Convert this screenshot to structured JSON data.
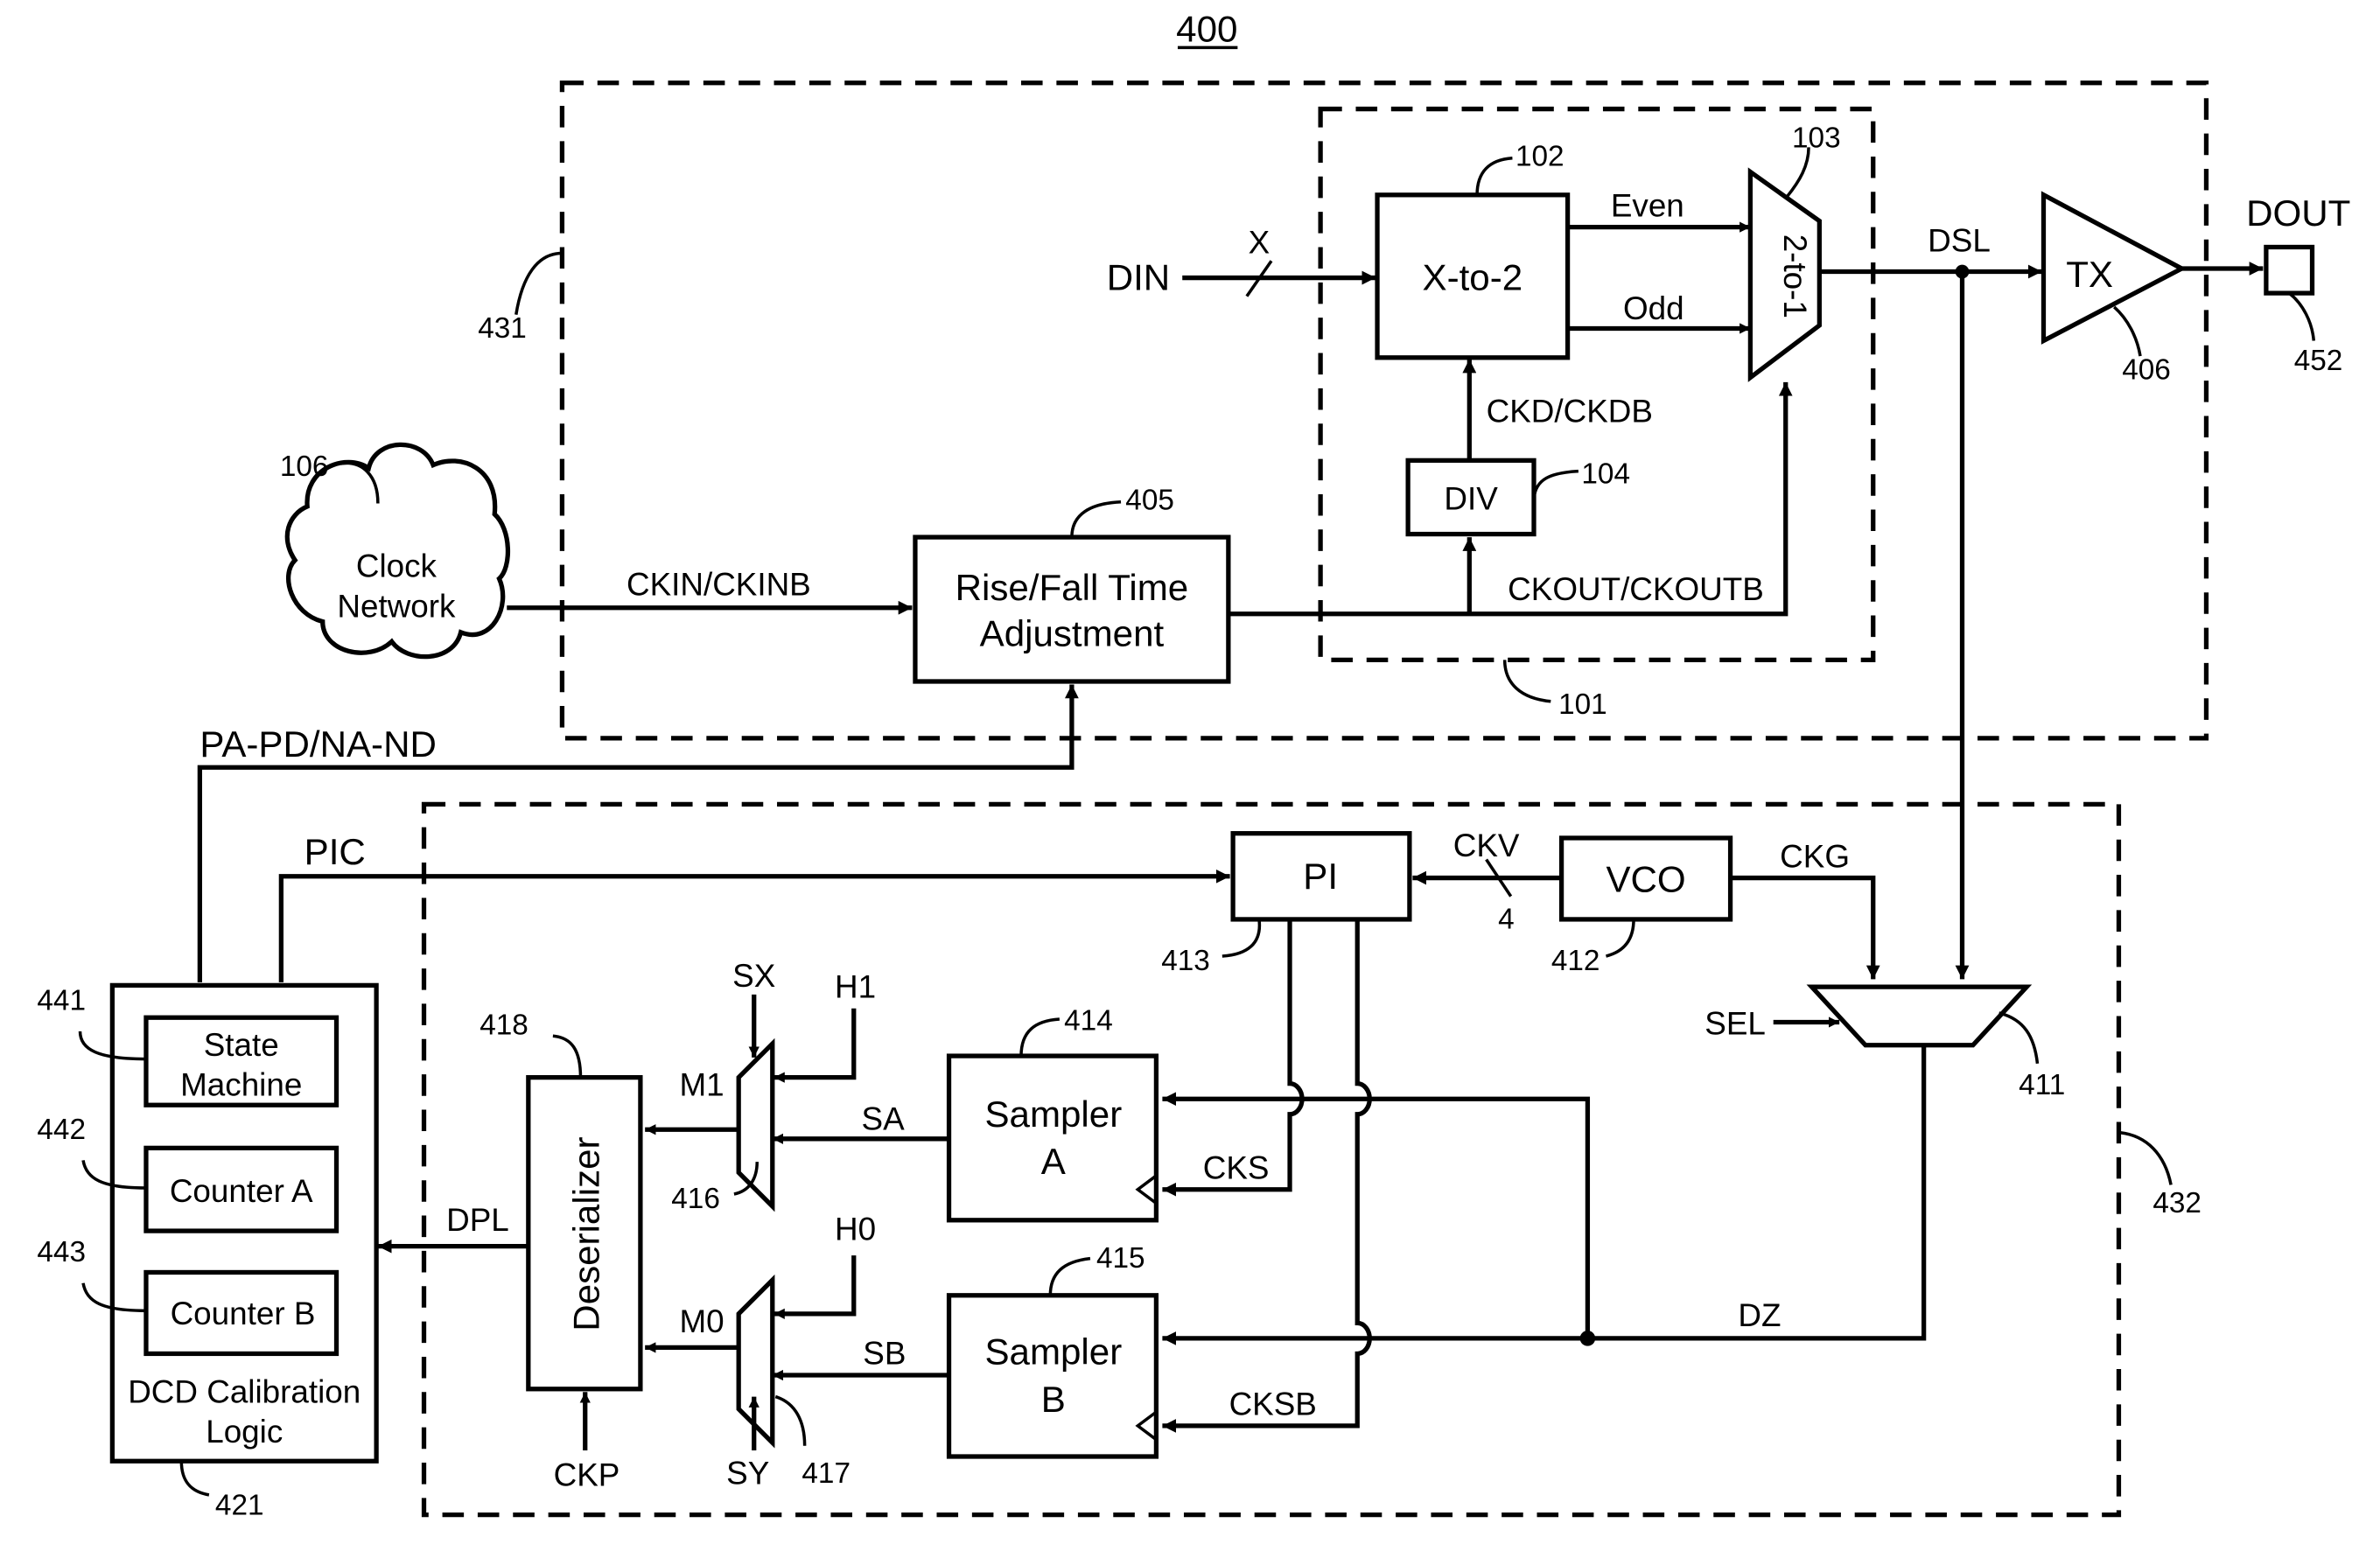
{
  "figure": {
    "number": "400",
    "colors": {
      "ink": "#000000",
      "background": "#ffffff"
    }
  },
  "regions": {
    "tx_region_ref": "431",
    "serializer_region_ref": "101",
    "rx_region_ref": "432"
  },
  "blocks": {
    "clock_network": {
      "ref": "106",
      "line1": "Clock",
      "line2": "Network"
    },
    "rise_fall": {
      "ref": "405",
      "line1": "Rise/Fall Time",
      "line2": "Adjustment"
    },
    "x_to_2": {
      "ref": "102",
      "label": "X-to-2"
    },
    "div": {
      "ref": "104",
      "label": "DIV"
    },
    "mux_2to1": {
      "ref": "103",
      "label": "2-to-1"
    },
    "tx": {
      "ref": "406",
      "label": "TX"
    },
    "dout_pad": {
      "ref": "452",
      "label": "DOUT"
    },
    "pi": {
      "ref": "413",
      "label": "PI"
    },
    "vco": {
      "ref": "412",
      "label": "VCO"
    },
    "mux_411": {
      "ref": "411"
    },
    "sampler_a": {
      "ref": "414",
      "line1": "Sampler",
      "line2": "A"
    },
    "sampler_b": {
      "ref": "415",
      "line1": "Sampler",
      "line2": "B"
    },
    "mux_416": {
      "ref": "416"
    },
    "mux_417": {
      "ref": "417"
    },
    "deserializer": {
      "ref": "418",
      "label": "Deserializer"
    },
    "dcd_logic": {
      "ref": "421",
      "line1": "DCD Calibration",
      "line2": "Logic",
      "state_machine": {
        "ref": "441",
        "line1": "State",
        "line2": "Machine"
      },
      "counter_a": {
        "ref": "442",
        "label": "Counter A"
      },
      "counter_b": {
        "ref": "443",
        "label": "Counter B"
      }
    }
  },
  "signals": {
    "din": "DIN",
    "bus_width_x": "X",
    "even": "Even",
    "odd": "Odd",
    "ckd": "CKD/CKDB",
    "ckout": "CKOUT/CKOUTB",
    "ckin": "CKIN/CKINB",
    "dsl": "DSL",
    "pa_pd": "PA-PD/NA-ND",
    "pic": "PIC",
    "ckv": "CKV",
    "ckv_width": "4",
    "ckg": "CKG",
    "sel": "SEL",
    "sx": "SX",
    "sy": "SY",
    "h1": "H1",
    "h0": "H0",
    "m1": "M1",
    "m0": "M0",
    "sa": "SA",
    "sb": "SB",
    "cks": "CKS",
    "cksb": "CKSB",
    "dz": "DZ",
    "dpl": "DPL",
    "ckp": "CKP"
  }
}
